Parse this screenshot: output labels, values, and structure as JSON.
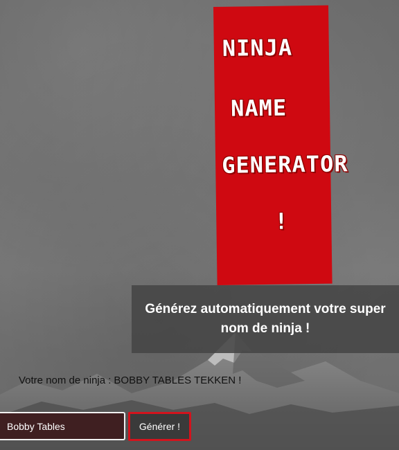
{
  "title": {
    "line1": "NINJA",
    "line2": "NAME",
    "line3": "GENERATOR",
    "line4": "!"
  },
  "subtitle": "Générez automatiquement votre super nom de ninja !",
  "result": {
    "label": "Votre nom de ninja :",
    "value": "BOBBY TABLES TEKKEN !"
  },
  "form": {
    "input_value": "Bobby Tables",
    "button_label": "Générer !"
  },
  "colors": {
    "banner_red": "#cf0911",
    "button_border": "#d3131d",
    "subtitle_bg": "#464646"
  }
}
